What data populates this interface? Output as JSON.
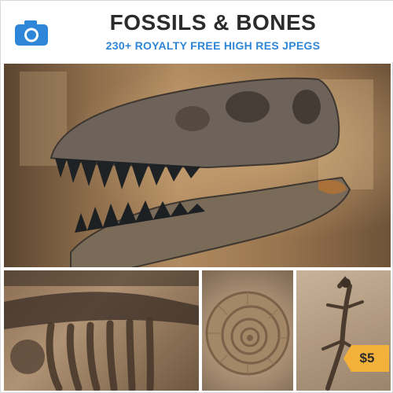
{
  "header": {
    "title": "FOSSILS & BONES",
    "subtitle": "230+ ROYALTY FREE HIGH RES JPEGS",
    "icon": "camera-icon",
    "accent_color": "#2e86d8"
  },
  "price_badge": {
    "label": "$5",
    "color": "#f4b13a"
  }
}
